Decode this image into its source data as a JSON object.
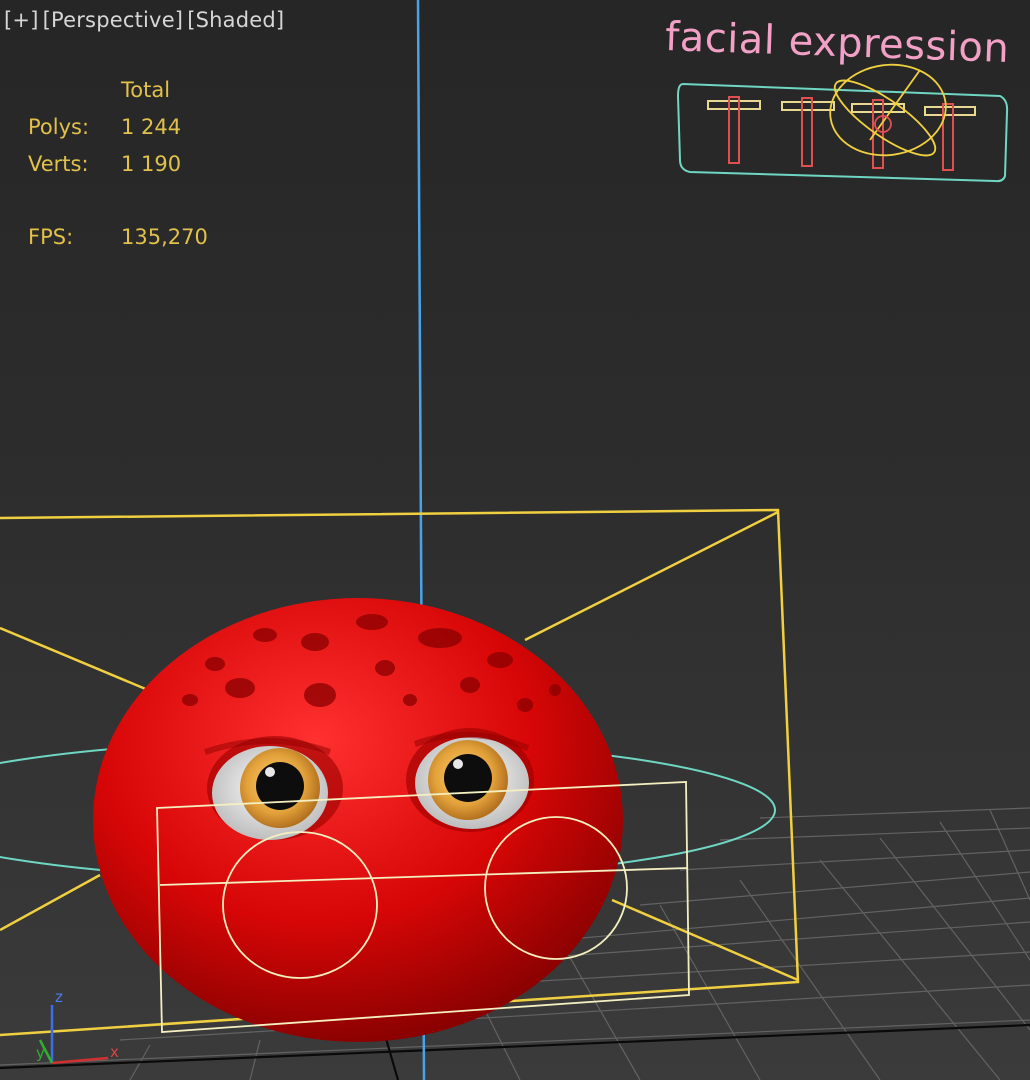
{
  "viewport": {
    "menu": {
      "plus_label": "[+]",
      "view_label": "[Perspective]",
      "shading_label": "[Shaded]"
    },
    "stats": {
      "header": "Total",
      "polys_label": "Polys:",
      "polys_value": "1 244",
      "verts_label": "Verts:",
      "verts_value": "1 190",
      "fps_label": "FPS:",
      "fps_value": "135,270"
    },
    "facial_rig": {
      "title": "facial expression"
    },
    "axis_gizmo": {
      "z": "z",
      "x": "x",
      "y": "y"
    },
    "colors": {
      "stats_text": "#e1c14a",
      "menu_text": "#d6d6d6",
      "rig_title": "#f2a0c6",
      "rig_frame": "#6fd6c4",
      "rig_handle": "#e05050",
      "selection_yellow": "#f0d040",
      "camera_blue": "#4aa3e8",
      "character_red": "#d80808"
    }
  }
}
